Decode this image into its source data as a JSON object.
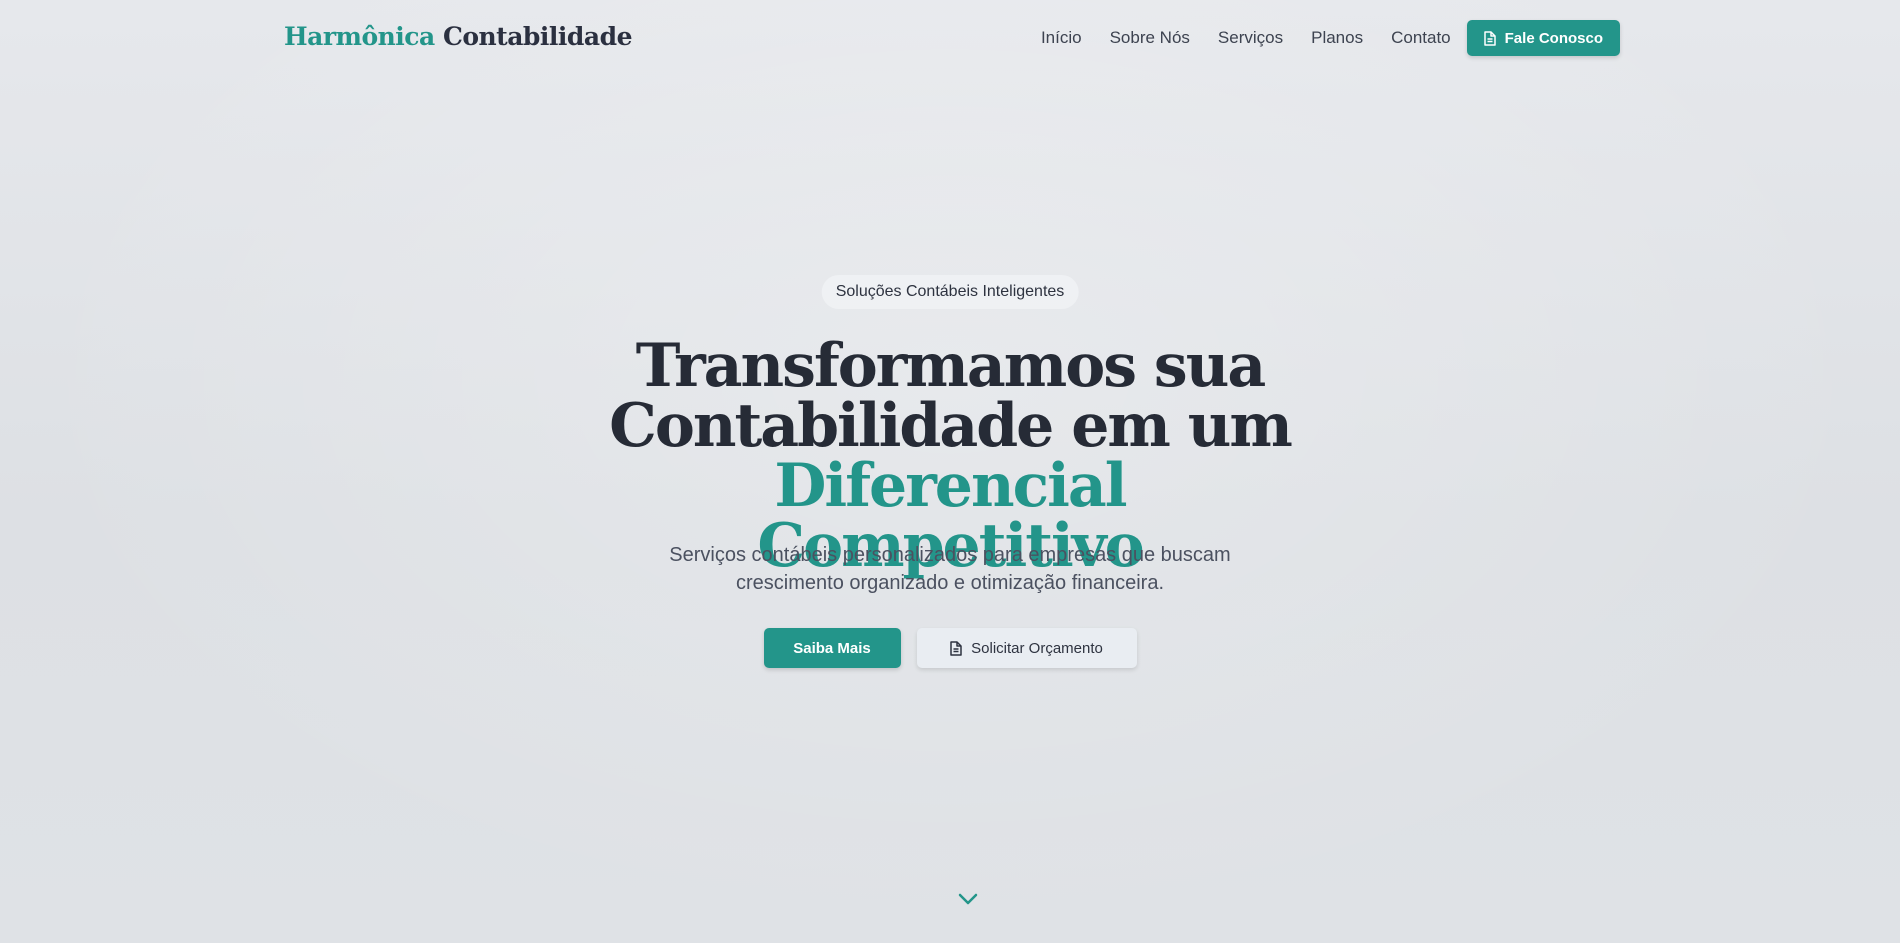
{
  "header": {
    "logo_accent": "Harmônica",
    "logo_dark": "Contabilidade",
    "nav": [
      "Início",
      "Sobre Nós",
      "Serviços",
      "Planos",
      "Contato"
    ],
    "cta_label": "Fale Conosco"
  },
  "hero": {
    "badge": "Soluções Contábeis Inteligentes",
    "headline_line1": "Transformamos sua",
    "headline_line2_dark": "Contabilidade em um",
    "headline_line2_accent": "Diferencial",
    "headline_line3_accent": "Competitivo",
    "subtitle": "Serviços contábeis personalizados para empresas que buscam crescimento organizado e otimização financeira.",
    "primary_button": "Saiba Mais",
    "secondary_button": "Solicitar Orçamento"
  },
  "icons": {
    "nav_cta_icon": "document-icon",
    "secondary_button_icon": "document-icon",
    "scroll_icon": "chevron-down-icon"
  },
  "colors": {
    "accent": "#23958a",
    "text_dark": "#262b36",
    "background": "#e3e6ea"
  }
}
